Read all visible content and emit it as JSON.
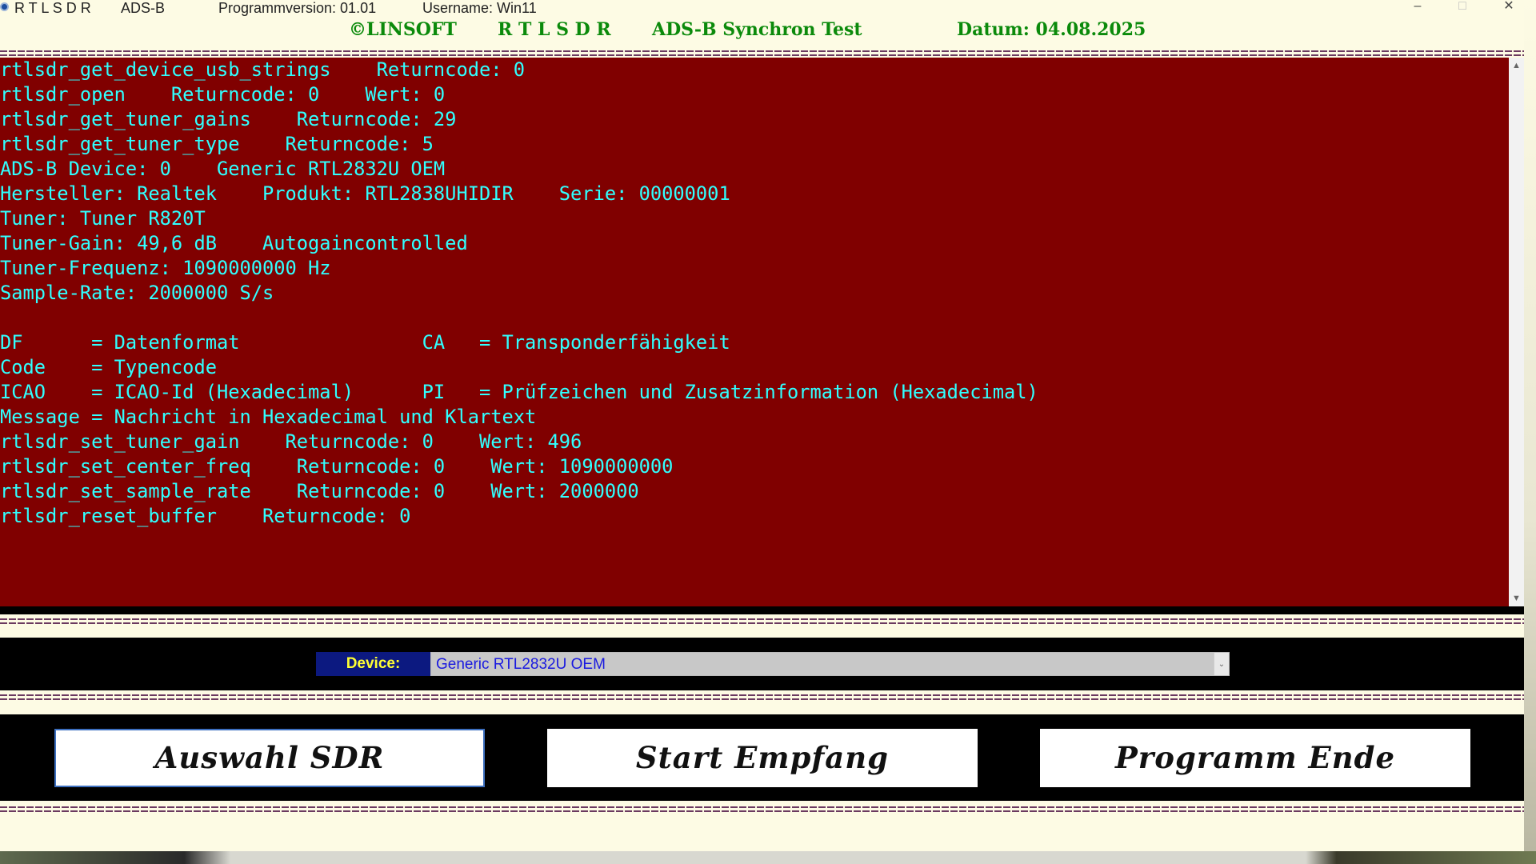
{
  "window": {
    "title_app": "R T L S D R",
    "title_mode": "ADS-B",
    "title_version": "Programmversion: 01.01",
    "title_user": "Username: Win11",
    "minimize": "–",
    "maximize": "□",
    "close": "✕"
  },
  "header": {
    "copyright": "©LINSOFT",
    "name": "R T L S D R",
    "test": "ADS-B Synchron Test",
    "date": "Datum: 04.08.2025"
  },
  "console": {
    "lines": [
      "rtlsdr_get_device_usb_strings    Returncode: 0",
      "rtlsdr_open    Returncode: 0    Wert: 0",
      "rtlsdr_get_tuner_gains    Returncode: 29",
      "rtlsdr_get_tuner_type    Returncode: 5",
      "ADS-B Device: 0    Generic RTL2832U OEM",
      "Hersteller: Realtek    Produkt: RTL2838UHIDIR    Serie: 00000001",
      "Tuner: Tuner R820T",
      "Tuner-Gain: 49,6 dB    Autogaincontrolled",
      "Tuner-Frequenz: 1090000000 Hz",
      "Sample-Rate: 2000000 S/s",
      "",
      "DF      = Datenformat                CA   = Transponderfähigkeit",
      "Code    = Typencode",
      "ICAO    = ICAO-Id (Hexadecimal)      PI   = Prüfzeichen und Zusatzinformation (Hexadecimal)",
      "Message = Nachricht in Hexadecimal und Klartext",
      "rtlsdr_set_tuner_gain    Returncode: 0    Wert: 496",
      "rtlsdr_set_center_freq    Returncode: 0    Wert: 1090000000",
      "rtlsdr_set_sample_rate    Returncode: 0    Wert: 2000000",
      "rtlsdr_reset_buffer    Returncode: 0"
    ]
  },
  "device": {
    "label": "Device:",
    "selected": "Generic RTL2832U OEM"
  },
  "buttons": {
    "select_sdr": "Auswahl SDR",
    "start": "Start Empfang",
    "exit": "Programm Ende"
  },
  "colors": {
    "console_bg": "#800000",
    "console_text": "#30ffff",
    "header_text": "#0b8a0b",
    "device_label_bg": "#0c1980",
    "device_label_text": "#ffff33"
  }
}
